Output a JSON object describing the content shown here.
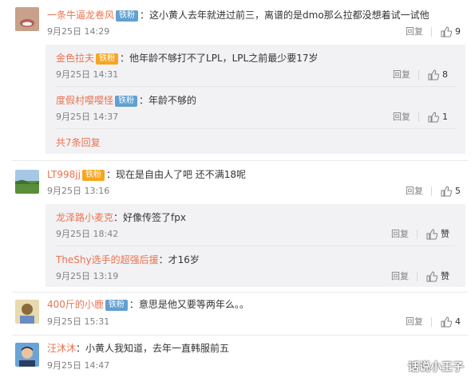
{
  "comments": [
    {
      "user": "一条牛逼龙卷风",
      "badge": "铁粉",
      "text": "：这小黄人去年就进过前三，离谱的是dmo那么拉都没想着试一试他",
      "time": "9月25日 14:29",
      "reply_label": "回复",
      "likes": "9",
      "replies": [
        {
          "user": "金色拉夫",
          "badge": "铁粉",
          "text": "：他年龄不够打不了LPL，LPL之前最少要17岁",
          "time": "9月25日 14:31",
          "reply_label": "回复",
          "likes": "8"
        },
        {
          "user": "度假村嘤嘤怪",
          "badge": "铁粉",
          "text": "：年龄不够的",
          "time": "9月25日 14:37",
          "reply_label": "回复",
          "likes": "1"
        }
      ],
      "more": "共7条回复"
    },
    {
      "user": "LT998jj",
      "badge": "铁粉",
      "text": "：现在是自由人了吧 还不满18呢",
      "time": "9月25日 13:16",
      "reply_label": "回复",
      "likes": "5",
      "replies": [
        {
          "user": "龙泽路小麦克",
          "text": "：好像传签了fpx",
          "time": "9月25日 18:42",
          "reply_label": "回复",
          "likes": "赞"
        },
        {
          "user": "TheShy选手的超强后援",
          "text": "：才16岁",
          "time": "9月25日 13:19",
          "reply_label": "回复",
          "likes": "赞"
        }
      ]
    },
    {
      "user": "400斤的小鹿",
      "badge": "铁粉",
      "text": "：意思是他又要等两年么。。",
      "time": "9月25日 15:31",
      "reply_label": "回复",
      "likes": "4"
    },
    {
      "user": "汪沐沐",
      "text": "：小黄人我知道，去年一直韩服前五",
      "time": "9月25日 14:47"
    }
  ],
  "watermark": "话说小王子",
  "colors": {
    "link": "#eb7350",
    "badge_iron": "#61a0d0",
    "badge_gold": "#f5a623",
    "subbox_bg": "#f2f2f5"
  }
}
